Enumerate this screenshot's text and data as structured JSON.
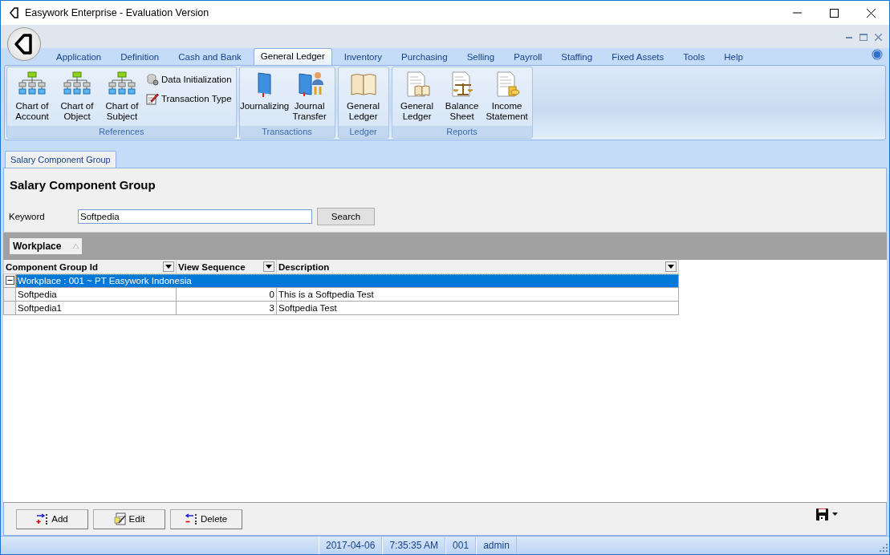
{
  "window": {
    "title": "Easywork Enterprise - Evaluation Version"
  },
  "menu_tabs": [
    {
      "label": "Application",
      "selected": false
    },
    {
      "label": "Definition",
      "selected": false
    },
    {
      "label": "Cash and Bank",
      "selected": false
    },
    {
      "label": "General Ledger",
      "selected": true
    },
    {
      "label": "Inventory",
      "selected": false
    },
    {
      "label": "Purchasing",
      "selected": false
    },
    {
      "label": "Selling",
      "selected": false
    },
    {
      "label": "Payroll",
      "selected": false
    },
    {
      "label": "Staffing",
      "selected": false
    },
    {
      "label": "Fixed Assets",
      "selected": false
    },
    {
      "label": "Tools",
      "selected": false
    },
    {
      "label": "Help",
      "selected": false
    }
  ],
  "ribbon_groups": [
    {
      "label": "References",
      "buttons": [
        {
          "label": "Chart of Account",
          "kind": "large"
        },
        {
          "label": "Chart of Object",
          "kind": "large"
        },
        {
          "label": "Chart of Subject",
          "kind": "large"
        },
        {
          "label": "Data Initialization",
          "kind": "small"
        },
        {
          "label": "Transaction Type",
          "kind": "small"
        }
      ]
    },
    {
      "label": "Transactions",
      "buttons": [
        {
          "label": "Journalizing",
          "kind": "large"
        },
        {
          "label": "Journal Transfer",
          "kind": "large"
        }
      ]
    },
    {
      "label": "Ledger",
      "buttons": [
        {
          "label": "General Ledger",
          "kind": "large"
        }
      ]
    },
    {
      "label": "Reports",
      "buttons": [
        {
          "label": "General Ledger",
          "kind": "large"
        },
        {
          "label": "Balance Sheet",
          "kind": "large"
        },
        {
          "label": "Income Statement",
          "kind": "large"
        }
      ]
    }
  ],
  "document_tabs": [
    {
      "label": "Salary Component Group",
      "selected": true
    }
  ],
  "page": {
    "heading": "Salary Component Group",
    "keyword_label": "Keyword",
    "keyword": "Softpedia",
    "search_button": "Search"
  },
  "grid": {
    "group_by": "Workplace",
    "columns": [
      {
        "label": "Component Group Id"
      },
      {
        "label": "View Sequence"
      },
      {
        "label": "Description"
      }
    ],
    "group_row": {
      "label": "Workplace : 001 ~ PT Easywork Indonesia",
      "expanded": true,
      "selected": true
    },
    "rows": [
      {
        "cells": [
          "Softpedia",
          "0",
          "This is a Softpedia Test"
        ]
      },
      {
        "cells": [
          "Softpedia1",
          "3",
          "Softpedia Test"
        ]
      }
    ]
  },
  "buttons": [
    "Add",
    "Edit",
    "Delete"
  ],
  "status_bar": [
    "2017-04-06",
    "7:35:35 AM",
    "001",
    "admin"
  ]
}
